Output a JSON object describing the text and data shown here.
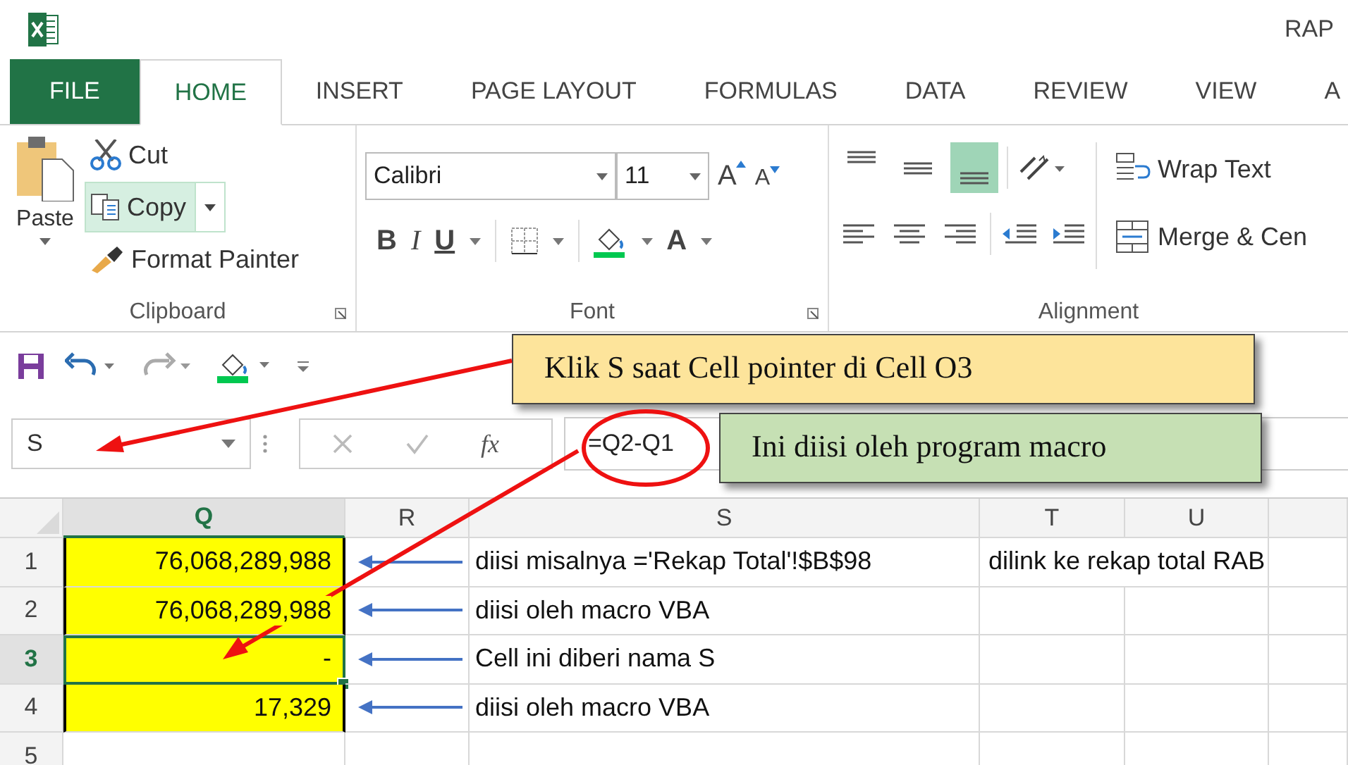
{
  "window": {
    "title": "RAP"
  },
  "tabs": [
    {
      "label": "FILE",
      "kind": "file",
      "selected": false
    },
    {
      "label": "HOME",
      "kind": "tab",
      "selected": true
    },
    {
      "label": "INSERT",
      "kind": "tab",
      "selected": false
    },
    {
      "label": "PAGE LAYOUT",
      "kind": "tab",
      "selected": false
    },
    {
      "label": "FORMULAS",
      "kind": "tab",
      "selected": false
    },
    {
      "label": "DATA",
      "kind": "tab",
      "selected": false
    },
    {
      "label": "REVIEW",
      "kind": "tab",
      "selected": false
    },
    {
      "label": "VIEW",
      "kind": "tab",
      "selected": false
    },
    {
      "label": "A",
      "kind": "tab",
      "selected": false
    }
  ],
  "clipboard": {
    "label": "Clipboard",
    "paste": "Paste",
    "cut": "Cut",
    "copy": {
      "label": "Copy",
      "hovered": true
    },
    "format_painter": "Format Painter"
  },
  "font": {
    "label": "Font",
    "name": "Calibri",
    "size": "11",
    "grow": "A",
    "shrink": "A",
    "bold": "B",
    "italic": "I",
    "underline": "U",
    "font_color": "A"
  },
  "alignment": {
    "label": "Alignment",
    "vertical": [
      {
        "kind": "top",
        "selected": false
      },
      {
        "kind": "middle",
        "selected": false
      },
      {
        "kind": "bottom",
        "selected": true
      }
    ],
    "wrap_text": "Wrap Text",
    "merge": "Merge & Cen"
  },
  "formula_bar": {
    "name_box": "S",
    "function_label": "fx",
    "formula": "=Q2-Q1"
  },
  "columns": [
    "Q",
    "R",
    "S",
    "T",
    "U",
    ""
  ],
  "rows": [
    {
      "header": "1",
      "q": "76,068,289,988",
      "s": "diisi misalnya ='Rekap Total'!$B$98",
      "t": "dilink ke rekap total RAB",
      "highlighted": true,
      "arrow": true,
      "selected": false
    },
    {
      "header": "2",
      "q": "76,068,289,988",
      "s": "diisi oleh macro VBA",
      "t": "",
      "highlighted": true,
      "arrow": true,
      "selected": false
    },
    {
      "header": "3",
      "q": "-",
      "s": "Cell ini diberi nama S",
      "t": "",
      "highlighted": true,
      "arrow": true,
      "selected": true
    },
    {
      "header": "4",
      "q": "17,329",
      "s": "diisi oleh macro VBA",
      "t": "",
      "highlighted": true,
      "arrow": true,
      "selected": false
    },
    {
      "header": "5",
      "q": "",
      "s": "",
      "t": "",
      "highlighted": false,
      "arrow": false,
      "selected": false
    }
  ],
  "callouts": [
    {
      "text": "Klik S saat Cell pointer di Cell O3",
      "color": "#fde49b"
    },
    {
      "text": "Ini diisi oleh program macro",
      "color": "#c6e0b4"
    }
  ]
}
